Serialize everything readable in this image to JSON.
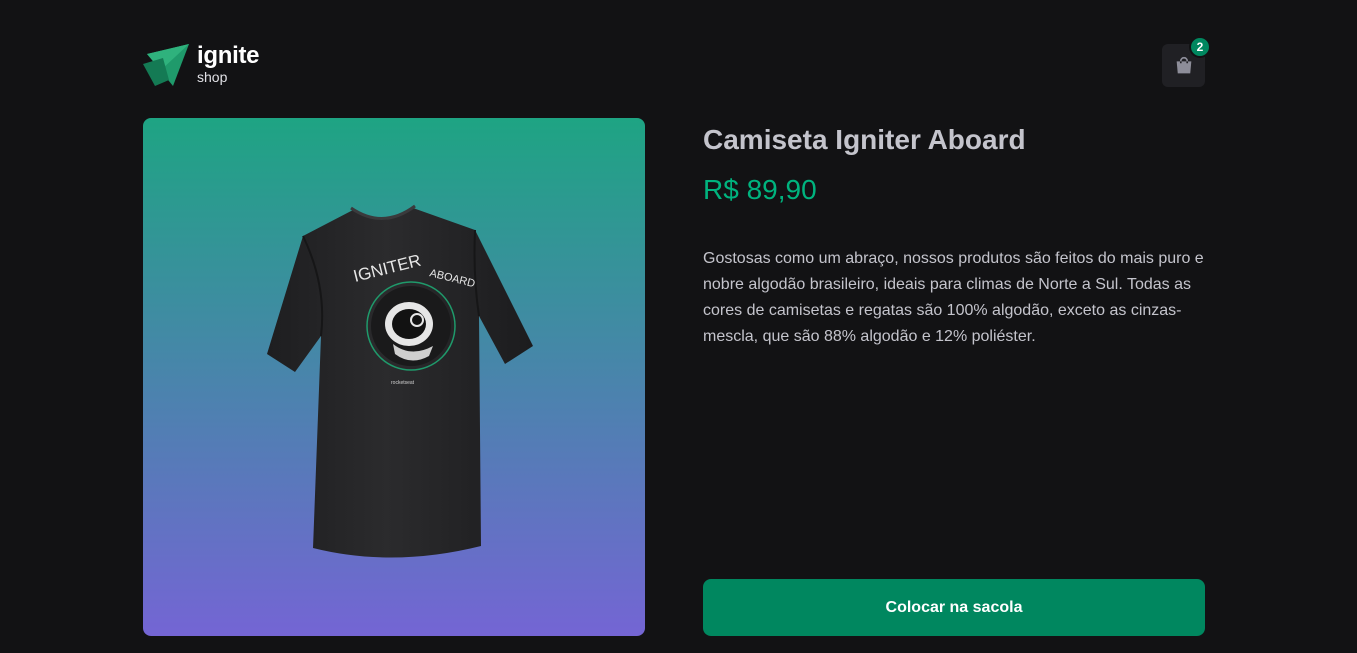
{
  "header": {
    "logo_title": "ignite",
    "logo_subtitle": "shop",
    "cart_count": "2"
  },
  "product": {
    "title": "Camiseta Igniter Aboard",
    "price": "R$ 89,90",
    "description": "Gostosas como um abraço, nossos produtos são feitos do mais puro e nobre algodão brasileiro, ideais para climas de Norte a Sul. Todas as cores de camisetas e regatas são 100% algodão, exceto as cinzas-mescla, que são 88% algodão e 12% poliéster.",
    "button_label": "Colocar na sacola",
    "print_text": "IGNITER ABOARD",
    "brand_tag": "rocketseat"
  },
  "icons": {
    "logo": "ignite-logo-icon",
    "cart": "shopping-bag-icon"
  },
  "colors": {
    "background": "#121214",
    "accent": "#00875f",
    "price": "#00b37e",
    "gradient_top": "#1ea483",
    "gradient_bottom": "#7465d4"
  }
}
